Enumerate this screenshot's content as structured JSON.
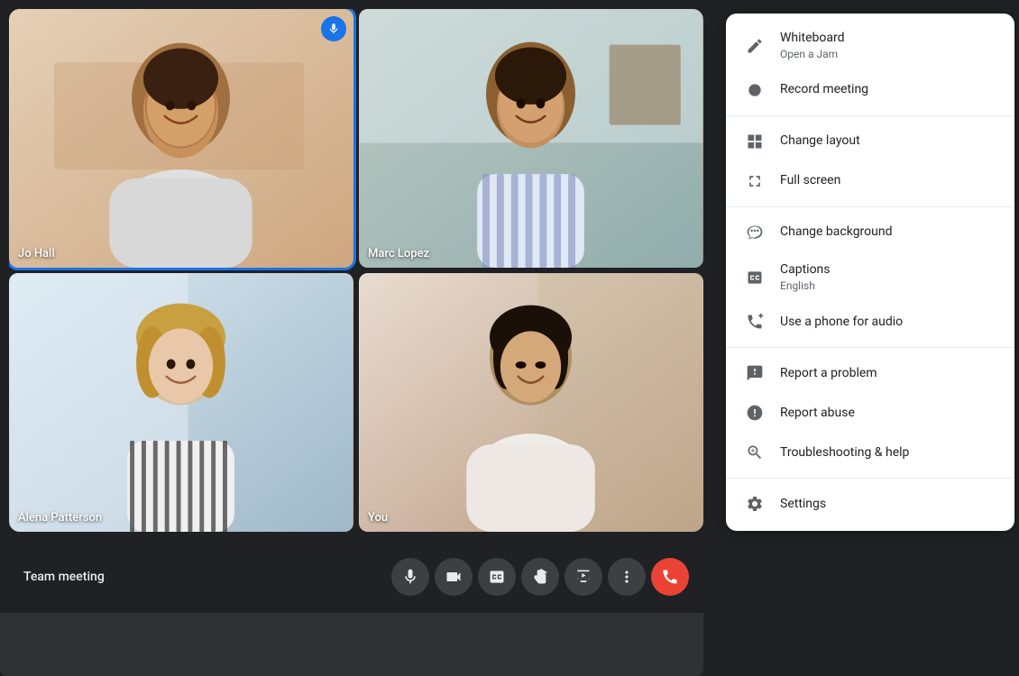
{
  "meeting": {
    "title": "Team meeting",
    "participants": [
      {
        "name": "Jo Hall",
        "tile_class": "tile-jo",
        "is_active_speaker": true,
        "has_mic_badge": true
      },
      {
        "name": "Marc Lopez",
        "tile_class": "tile-marc",
        "is_active_speaker": false,
        "has_mic_badge": false
      },
      {
        "name": "Alena Patterson",
        "tile_class": "tile-alena",
        "is_active_speaker": false,
        "has_mic_badge": false
      },
      {
        "name": "You",
        "tile_class": "tile-you",
        "is_active_speaker": false,
        "has_mic_badge": false
      }
    ]
  },
  "toolbar": {
    "meeting_title": "Team meeting",
    "buttons": [
      {
        "id": "mic",
        "label": "Microphone",
        "icon": "mic"
      },
      {
        "id": "camera",
        "label": "Camera",
        "icon": "videocam"
      },
      {
        "id": "captions",
        "label": "Captions",
        "icon": "cc"
      },
      {
        "id": "raise-hand",
        "label": "Raise hand",
        "icon": "hand"
      },
      {
        "id": "present",
        "label": "Present now",
        "icon": "present"
      },
      {
        "id": "more",
        "label": "More options",
        "icon": "more"
      },
      {
        "id": "end-call",
        "label": "Leave call",
        "icon": "call-end"
      }
    ]
  },
  "context_menu": {
    "items": [
      {
        "id": "whiteboard",
        "label": "Whiteboard",
        "sublabel": "Open a Jam",
        "icon": "pencil"
      },
      {
        "id": "record-meeting",
        "label": "Record meeting",
        "sublabel": "",
        "icon": "circle"
      },
      {
        "id": "change-layout",
        "label": "Change layout",
        "sublabel": "",
        "icon": "layout"
      },
      {
        "id": "full-screen",
        "label": "Full screen",
        "sublabel": "",
        "icon": "fullscreen"
      },
      {
        "id": "change-background",
        "label": "Change background",
        "sublabel": "",
        "icon": "background"
      },
      {
        "id": "captions",
        "label": "Captions",
        "sublabel": "English",
        "icon": "cc-square"
      },
      {
        "id": "phone-audio",
        "label": "Use a phone for audio",
        "sublabel": "",
        "icon": "phone"
      },
      {
        "id": "report-problem",
        "label": "Report a problem",
        "sublabel": "",
        "icon": "chat-alert"
      },
      {
        "id": "report-abuse",
        "label": "Report abuse",
        "sublabel": "",
        "icon": "warning"
      },
      {
        "id": "troubleshooting",
        "label": "Troubleshooting & help",
        "sublabel": "",
        "icon": "search-help"
      },
      {
        "id": "settings",
        "label": "Settings",
        "sublabel": "",
        "icon": "gear"
      }
    ]
  },
  "colors": {
    "accent": "#1a73e8",
    "end_call": "#ea4335",
    "toolbar_bg": "#202124",
    "tile_bg": "#3c4043",
    "menu_bg": "#ffffff",
    "text_primary": "#202124",
    "text_secondary": "#5f6368"
  }
}
